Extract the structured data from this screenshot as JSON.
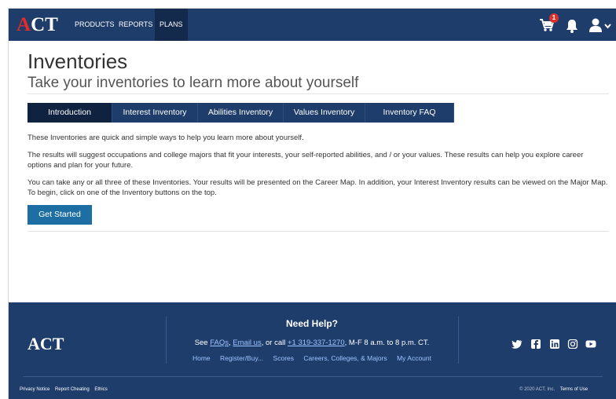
{
  "nav": {
    "logo": "ACT",
    "items": [
      "PRODUCTS",
      "REPORTS",
      "PLANS"
    ],
    "active": "PLANS",
    "cart_count": "1"
  },
  "header": {
    "title": "Inventories",
    "subtitle": "Take your inventories to learn more about yourself"
  },
  "tabs": [
    {
      "label": "Introduction",
      "active": true
    },
    {
      "label": "Interest Inventory"
    },
    {
      "label": "Abilities Inventory"
    },
    {
      "label": "Values Inventory"
    },
    {
      "label": "Inventory FAQ"
    }
  ],
  "content": {
    "p1": "These Inventories are quick and simple ways to help you learn more about yourself.",
    "p2": "The results will suggest occupations and college majors that fit your interests, your self-reported abilities, and / or your values. These results can help you explore career options and plan for your future.",
    "p3": "You can take any or all three of these Inventories. Your results will be presented on the Career Map. In addition, your Interest Inventory results can be viewed on the Major Map. To begin, click on one of the Inventory buttons on the top.",
    "button": "Get Started"
  },
  "footer": {
    "logo": "ACT",
    "help_title": "Need Help?",
    "help_see": "See ",
    "faqs": "FAQs",
    "comma": ", ",
    "email": "Email us",
    "or_call": ", or call ",
    "phone": "+1 319-337-1270",
    "hours": ", M-F 8 a.m. to 8 p.m. CT.",
    "links": [
      "Home",
      "Register/Buy...",
      "Scores",
      "Careers, Colleges, & Majors",
      "My Account"
    ],
    "social": [
      "twitter-icon",
      "facebook-icon",
      "linkedin-icon",
      "instagram-icon",
      "youtube-icon"
    ],
    "bottom_left": [
      "Privacy Notice",
      "Report Cheating",
      "Ethics"
    ],
    "copyright": "© 2020 ACT, Inc.",
    "terms": "Terms of Use"
  }
}
